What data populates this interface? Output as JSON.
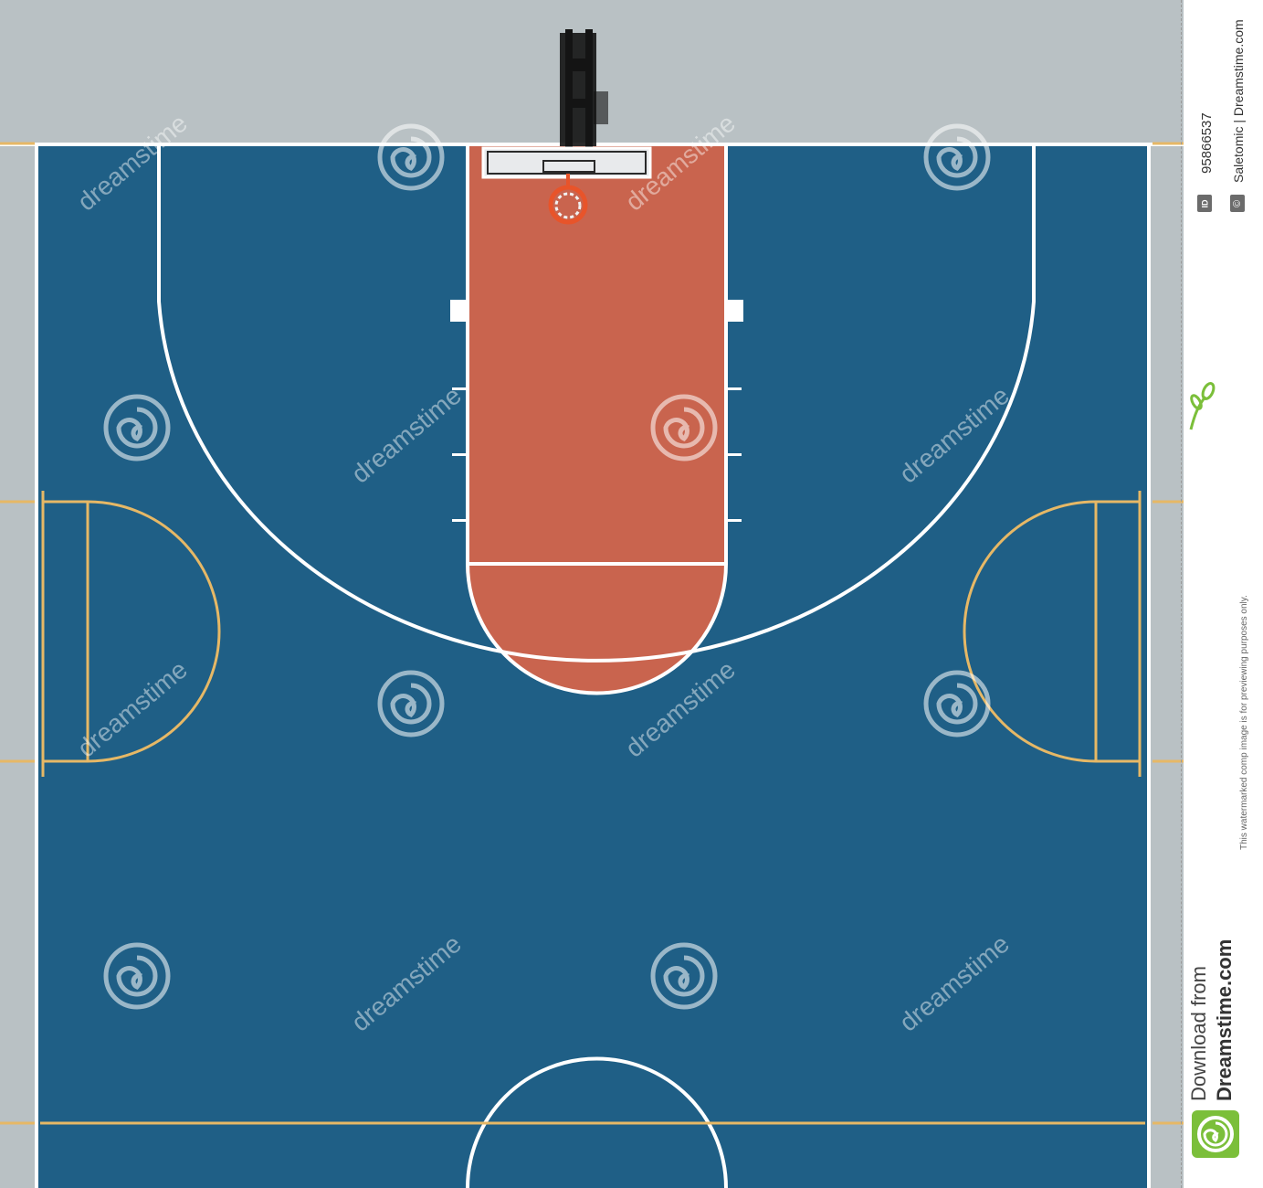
{
  "watermark": {
    "text": "dreamstime"
  },
  "sidebar": {
    "id_badge": "ID",
    "image_id": "95866537",
    "copyright_badge": "©",
    "credit": "Saletomic | Dreamstime.com",
    "preview_note": "This watermarked comp image is for previewing purposes only.",
    "download_from": "Download from",
    "site_name": "Dreamstime.com"
  },
  "colors": {
    "court_blue": "#1f5f86",
    "paint_red": "#c9644e",
    "surround_gray": "#b9c1c4",
    "line_white": "#ffffff",
    "line_yellow": "#e6b866",
    "logo_green": "#7bbf3a"
  }
}
